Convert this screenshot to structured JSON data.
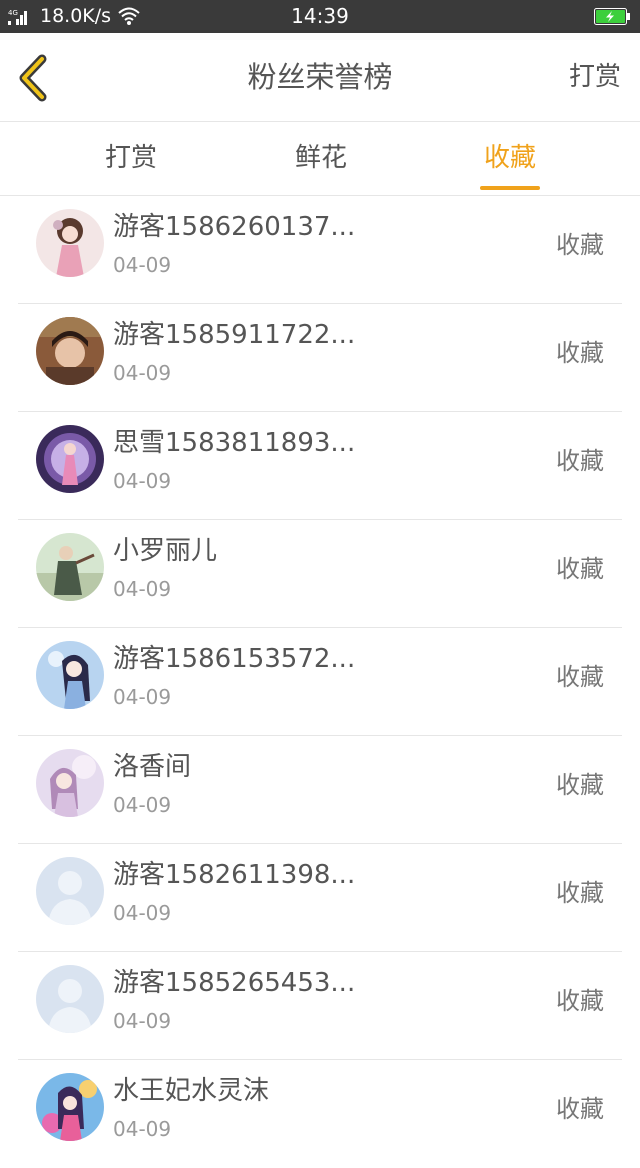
{
  "status_bar": {
    "network_speed": "18.0K/s",
    "time": "14:39",
    "signal_icon": "signal-4g-icon",
    "wifi_icon": "wifi-icon",
    "battery_icon": "battery-charging-icon"
  },
  "header": {
    "back_icon": "chevron-left-icon",
    "title": "粉丝荣誉榜",
    "right_action": "打赏",
    "accent_color": "#f0a21b"
  },
  "tabs": [
    {
      "label": "打赏",
      "active": false
    },
    {
      "label": "鲜花",
      "active": false
    },
    {
      "label": "收藏",
      "active": true
    }
  ],
  "fans": [
    {
      "name": "游客1586260137...",
      "date": "04-09",
      "action": "收藏",
      "avatar": "avatar-girl-pink"
    },
    {
      "name": "游客1585911722...",
      "date": "04-09",
      "action": "收藏",
      "avatar": "avatar-photo-girl"
    },
    {
      "name": "思雪1583811893...",
      "date": "04-09",
      "action": "收藏",
      "avatar": "avatar-purple-portal"
    },
    {
      "name": "小罗丽儿",
      "date": "04-09",
      "action": "收藏",
      "avatar": "avatar-warrior"
    },
    {
      "name": "游客1586153572...",
      "date": "04-09",
      "action": "收藏",
      "avatar": "avatar-anime-blue"
    },
    {
      "name": "洛香间",
      "date": "04-09",
      "action": "收藏",
      "avatar": "avatar-anime-pastel"
    },
    {
      "name": "游客1582611398...",
      "date": "04-09",
      "action": "收藏",
      "avatar": "avatar-default"
    },
    {
      "name": "游客1585265453...",
      "date": "04-09",
      "action": "收藏",
      "avatar": "avatar-default"
    },
    {
      "name": "水王妃水灵沫",
      "date": "04-09",
      "action": "收藏",
      "avatar": "avatar-anime-colorful"
    }
  ]
}
